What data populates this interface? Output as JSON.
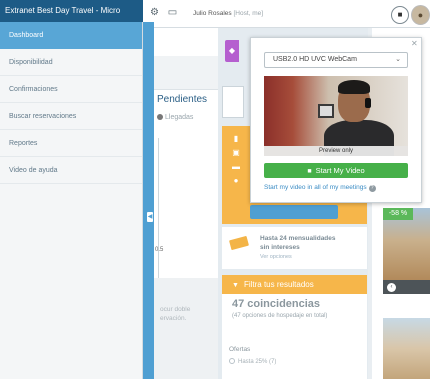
{
  "window": {
    "title": "Extranet Best Day Travel - Micro"
  },
  "topbar": {
    "user_name": "Julio Rosales",
    "user_status": "[Host, me]"
  },
  "sidebar": {
    "items": [
      {
        "label": "Dashboard",
        "active": true
      },
      {
        "label": "Disponibilidad",
        "active": false
      },
      {
        "label": "Confirmaciones",
        "active": false
      },
      {
        "label": "Buscar reservaciones",
        "active": false
      },
      {
        "label": "Reportes",
        "active": false
      },
      {
        "label": "Video de ayuda",
        "active": false
      }
    ]
  },
  "main": {
    "section_title": "Pendientes",
    "radio_label": "Llegadas",
    "axis_value": "0.5",
    "grey_text_line1": "ocur doble",
    "grey_text_line2": "ervación."
  },
  "promo": {
    "title_line1": "Hasta 24 mensualidades",
    "title_line2": "sin intereses",
    "subtitle": "Ver opciones"
  },
  "filters": {
    "bar_label": "Filtra tus resultados",
    "count": "47 coincidencias",
    "sub": "(47 opciones de hospedaje en total)",
    "ofertas_label": "Ofertas",
    "option_1": "Hasta 25% (7)"
  },
  "hotel": {
    "discount": "-58 %",
    "nav_arrow": "‹"
  },
  "webcam": {
    "device": "USB2.0 HD UVC WebCam",
    "preview_caption": "Preview only",
    "start_button": "Start My Video",
    "start_link": "Start my video in all of my meetings"
  },
  "colors": {
    "sidebar_active": "#58a6d6",
    "accent_blue": "#4f9fd2",
    "orange": "#f6b64a",
    "green": "#46b049",
    "purple": "#b55fcf"
  }
}
